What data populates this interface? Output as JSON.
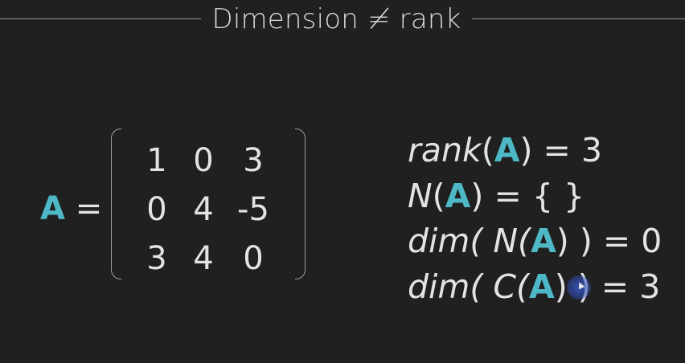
{
  "title": "Dimension ≠ rank",
  "matrix": {
    "name": "A",
    "equals": "=",
    "rows": [
      [
        "1",
        "0",
        "3"
      ],
      [
        "0",
        "4",
        "-5"
      ],
      [
        "3",
        "4",
        "0"
      ]
    ]
  },
  "properties": [
    {
      "pre": "",
      "func": "rank",
      "open": "(",
      "arg": "A",
      "close": ")",
      "rest": " = 3"
    },
    {
      "pre": "",
      "func": "N",
      "open": "(",
      "arg": "A",
      "close": ")",
      "rest": " = { }"
    },
    {
      "pre": "",
      "func": "dim",
      "open": "( N(",
      "arg": "A",
      "close": ")",
      "rest": " ) = 0"
    },
    {
      "pre": "",
      "func": "dim",
      "open": "( C(",
      "arg": "A",
      "close": ")",
      "rest": " ) = 3"
    }
  ],
  "colors": {
    "background": "#202020",
    "accent": "#4eb8c6",
    "text": "#e3e3e3",
    "rule": "#9a9a9a"
  },
  "icons": {
    "cursor": "pointer-cursor-icon"
  }
}
